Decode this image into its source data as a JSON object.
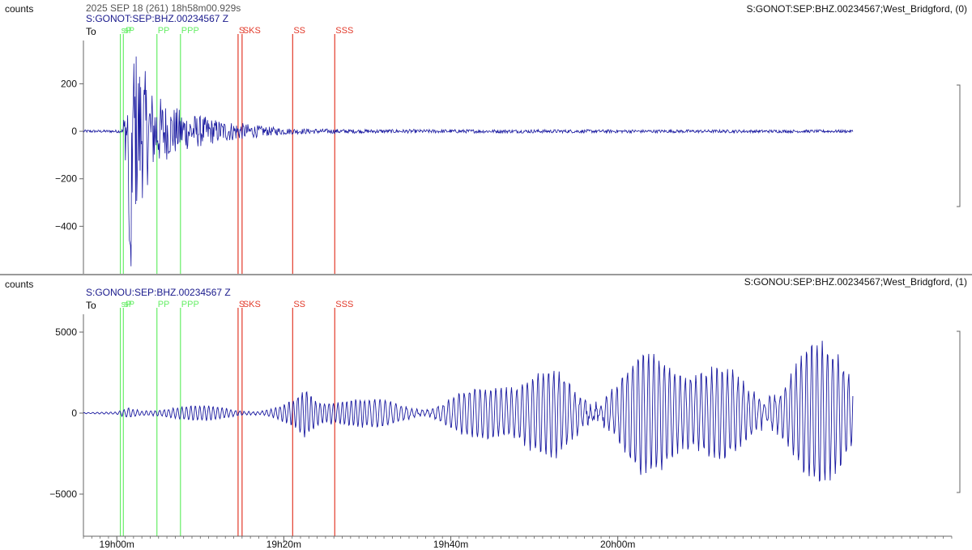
{
  "header": {
    "ylabel": "counts",
    "datetime": "2025 SEP 18 (261)  18h58m00.929s"
  },
  "colors": {
    "trace": "#1a1aa0",
    "p_phase": "#66ee66",
    "s_phase": "#e23a2a",
    "axis": "#666666"
  },
  "chart_data": [
    {
      "type": "line",
      "channel": "S:GONOT:SEP:BHZ.00234567 Z",
      "station_info": "S:GONOT:SEP:BHZ.00234567;West_Bridgford, (0)",
      "origin_label": "To",
      "ylabel": "counts",
      "y_ticks": [
        200,
        0,
        -200,
        -400
      ],
      "y_tick_labels": [
        "200",
        "0",
        "−200",
        "−400"
      ],
      "ylim": [
        -600,
        430
      ],
      "trace_envelope": [
        [
          18.9,
          6
        ],
        [
          19.01,
          6
        ],
        [
          19.023,
          230
        ],
        [
          19.03,
          420
        ],
        [
          19.045,
          320
        ],
        [
          19.07,
          180
        ],
        [
          19.1,
          120
        ],
        [
          19.14,
          80
        ],
        [
          19.2,
          50
        ],
        [
          19.3,
          20
        ],
        [
          19.35,
          12
        ],
        [
          19.5,
          8
        ],
        [
          20.47,
          6
        ]
      ],
      "trace_negative_peak": -570
    },
    {
      "type": "line",
      "channel": "S:GONOU:SEP:BHZ.00234567 Z",
      "station_info": "S:GONOU:SEP:BHZ.00234567;West_Bridgford, (1)",
      "origin_label": "To",
      "ylabel": "counts",
      "y_ticks": [
        5000,
        0,
        -5000
      ],
      "y_tick_labels": [
        "5000",
        "0",
        "−5000"
      ],
      "ylim": [
        -7600,
        6800
      ],
      "trace_envelope": [
        [
          18.9,
          80
        ],
        [
          19.0,
          120
        ],
        [
          19.023,
          600
        ],
        [
          19.05,
          400
        ],
        [
          19.1,
          450
        ],
        [
          19.3,
          500
        ],
        [
          19.35,
          1200
        ],
        [
          19.38,
          2500
        ],
        [
          19.4,
          1400
        ],
        [
          19.5,
          900
        ],
        [
          19.6,
          1300
        ],
        [
          19.7,
          1800
        ],
        [
          19.8,
          2800
        ],
        [
          19.9,
          3800
        ],
        [
          20.0,
          4000
        ],
        [
          20.1,
          4300
        ],
        [
          20.2,
          4200
        ],
        [
          20.3,
          4300
        ],
        [
          20.47,
          4500
        ]
      ]
    }
  ],
  "phases": [
    {
      "name": "sP",
      "time": 19.007,
      "kind": "p"
    },
    {
      "name": "sP",
      "time": 19.013,
      "kind": "p"
    },
    {
      "name": "PP",
      "time": 19.08,
      "kind": "p"
    },
    {
      "name": "PPP",
      "time": 19.127,
      "kind": "p"
    },
    {
      "name": "S",
      "time": 19.242,
      "kind": "s"
    },
    {
      "name": "SKS",
      "time": 19.25,
      "kind": "s"
    },
    {
      "name": "SS",
      "time": 19.351,
      "kind": "s"
    },
    {
      "name": "SSS",
      "time": 19.435,
      "kind": "s"
    }
  ],
  "time_axis": {
    "xlim": [
      18.9333,
      20.6667
    ],
    "ticks": [
      19.0,
      19.3333,
      19.6667,
      20.0
    ],
    "tick_labels": [
      "19h00m",
      "19h20m",
      "19h40m",
      "20h00m"
    ]
  }
}
